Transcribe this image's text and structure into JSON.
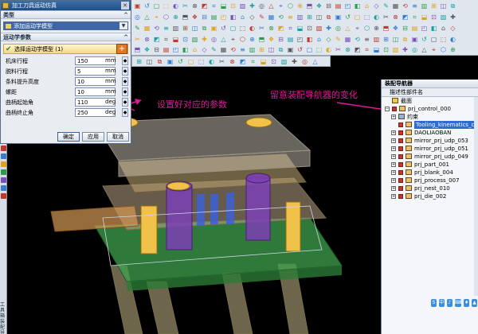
{
  "dialog": {
    "title": "加工刀具运动仿真",
    "type_section": "类型",
    "type_value": "添加运动学模型",
    "params_section": "运动学参数",
    "select_model": "选择运动学模型 (1)",
    "params": [
      {
        "label": "机床行程",
        "value": "150",
        "unit": "mm"
      },
      {
        "label": "脱料行程",
        "value": "5",
        "unit": "mm"
      },
      {
        "label": "条料提升高度",
        "value": "10",
        "unit": "mm"
      },
      {
        "label": "螺距",
        "value": "10",
        "unit": "mm"
      },
      {
        "label": "曲柄起始角",
        "value": "110",
        "unit": "deg"
      },
      {
        "label": "曲柄终止角",
        "value": "250",
        "unit": "deg"
      }
    ],
    "ok_label": "确定",
    "apply_label": "应用",
    "cancel_label": "取消"
  },
  "annotations": {
    "params_note": "设置好对应的参数",
    "nav_note": "留意装配导航器的变化"
  },
  "navigator": {
    "title": "装配导航器",
    "column": "描述性部件名",
    "items": [
      {
        "label": "截面",
        "indent": 0,
        "expander": "",
        "icon": "folder",
        "checked": false
      },
      {
        "label": "prj_control_000",
        "indent": 0,
        "expander": "−",
        "icon": "assembly",
        "checked": true
      },
      {
        "label": "约束",
        "indent": 1,
        "expander": "+",
        "icon": "constraint",
        "checked": false
      },
      {
        "label": "Tooling_kinematics_c",
        "indent": 1,
        "expander": "",
        "icon": "part",
        "checked": true,
        "selected": true
      },
      {
        "label": "DAOLIAOBAN",
        "indent": 1,
        "expander": "+",
        "icon": "part",
        "checked": true
      },
      {
        "label": "mirror_prj_udp_053",
        "indent": 1,
        "expander": "+",
        "icon": "part",
        "checked": true
      },
      {
        "label": "mirror_prj_udp_051",
        "indent": 1,
        "expander": "+",
        "icon": "part",
        "checked": true
      },
      {
        "label": "mirror_prj_udp_049",
        "indent": 1,
        "expander": "+",
        "icon": "part",
        "checked": true
      },
      {
        "label": "prj_part_001",
        "indent": 1,
        "expander": "+",
        "icon": "part",
        "checked": true
      },
      {
        "label": "prj_blank_004",
        "indent": 1,
        "expander": "+",
        "icon": "part",
        "checked": true
      },
      {
        "label": "prj_process_007",
        "indent": 1,
        "expander": "+",
        "icon": "part",
        "checked": true
      },
      {
        "label": "prj_nest_010",
        "indent": 1,
        "expander": "+",
        "icon": "part",
        "checked": true
      },
      {
        "label": "prj_die_002",
        "indent": 1,
        "expander": "+",
        "icon": "part",
        "checked": true
      }
    ],
    "bottom_icons": [
      "S",
      "中",
      "♪",
      "⌨",
      "♦",
      "▲"
    ]
  },
  "left_bar_text": "工具\n箱\n装配\n导航\n器",
  "colors": {
    "annotation": "#e0189a",
    "selection": "#2f6bd4",
    "dialog_header": "#1f4f8a"
  }
}
